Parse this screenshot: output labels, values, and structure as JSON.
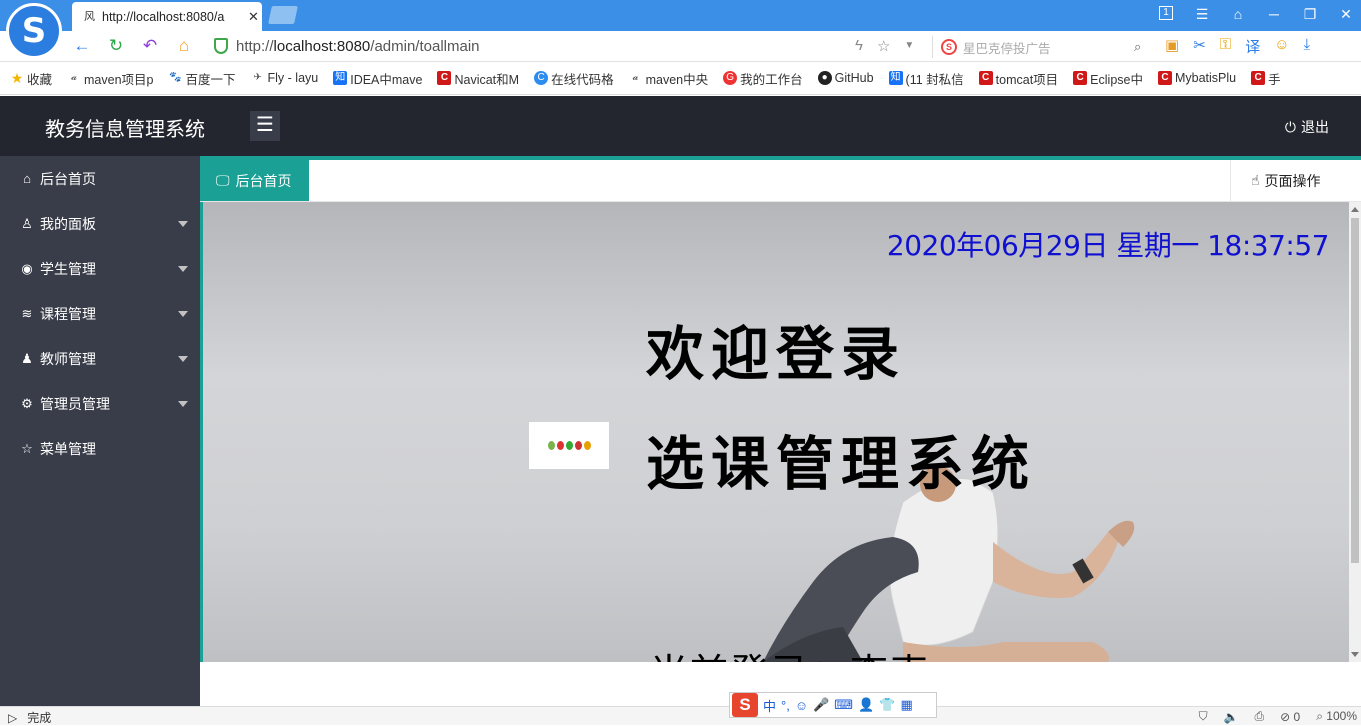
{
  "browser": {
    "tab_title": "http://localhost:8080/a",
    "url_prefix": "http://",
    "url_host": "localhost:8080",
    "url_path": "/admin/toallmain",
    "search_placeholder": "星巴克停投广告",
    "search_logo": "S",
    "tab_badge": "1"
  },
  "bookmarks": [
    {
      "icon": "star",
      "label": "收藏"
    },
    {
      "icon": "maven",
      "label": "maven项目p"
    },
    {
      "icon": "baidu",
      "label": "百度一下"
    },
    {
      "icon": "fly",
      "label": "Fly - layu"
    },
    {
      "icon": "zhihu",
      "label": "IDEA中mave"
    },
    {
      "icon": "csdn",
      "label": "Navicat和M"
    },
    {
      "icon": "c-circle",
      "label": "在线代码格"
    },
    {
      "icon": "maven",
      "label": "maven中央"
    },
    {
      "icon": "g-circle",
      "label": "我的工作台"
    },
    {
      "icon": "github",
      "label": "GitHub"
    },
    {
      "icon": "zhihu",
      "label": "(11 封私信"
    },
    {
      "icon": "csdn",
      "label": "tomcat项目"
    },
    {
      "icon": "csdn",
      "label": "Eclipse中"
    },
    {
      "icon": "csdn",
      "label": "MybatisPlu"
    },
    {
      "icon": "csdn",
      "label": "手"
    }
  ],
  "bookmark_glyphs": {
    "zhihu": "知",
    "csdn": "C",
    "c-circle": "C",
    "g-circle": "G"
  },
  "header": {
    "app_title": "教务信息管理系统",
    "logout_label": "退出"
  },
  "sidebar": {
    "items": [
      {
        "icon": "home-icon",
        "label": "后台首页",
        "expandable": false
      },
      {
        "icon": "user-icon",
        "label": "我的面板",
        "expandable": true
      },
      {
        "icon": "student-icon",
        "label": "学生管理",
        "expandable": true
      },
      {
        "icon": "layers-icon",
        "label": "课程管理",
        "expandable": true
      },
      {
        "icon": "teacher-icon",
        "label": "教师管理",
        "expandable": true
      },
      {
        "icon": "gear-icon",
        "label": "管理员管理",
        "expandable": true
      },
      {
        "icon": "star-icon",
        "label": "菜单管理",
        "expandable": false
      }
    ]
  },
  "tabs": {
    "active_label": "后台首页",
    "page_ops_label": "页面操作"
  },
  "main": {
    "datetime": "2020年06月29日 星期一 18:37:57",
    "welcome": "欢迎登录",
    "system_name": "选课管理系统",
    "current_user": "当前登录：李克"
  },
  "status": {
    "text": "完成",
    "count": "0",
    "zoom": "100%"
  },
  "ime": {
    "logo": "S",
    "mode": "中"
  },
  "colors": {
    "header_bg": "#23262e",
    "sidebar_bg": "#393d49",
    "accent": "#1aa094",
    "datetime": "#1010d0"
  }
}
